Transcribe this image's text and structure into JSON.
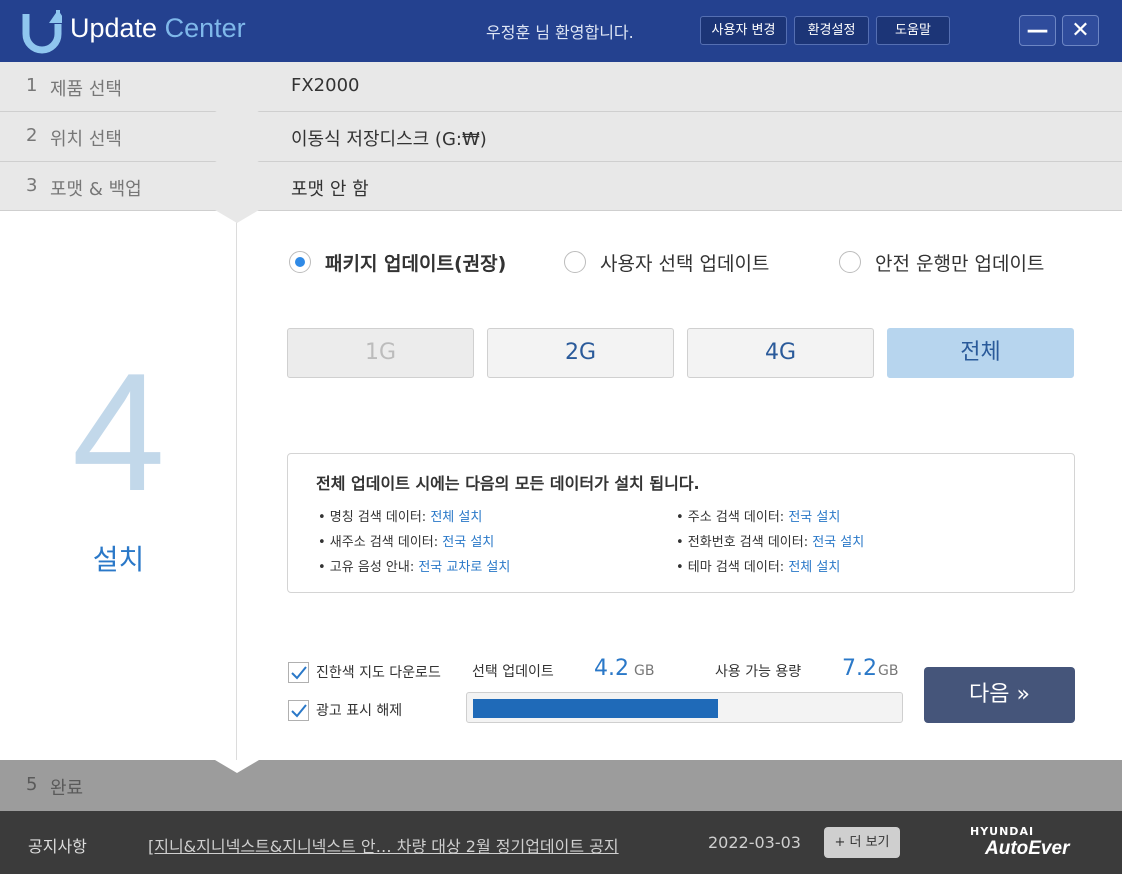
{
  "header": {
    "app_title_a": "Update ",
    "app_title_b": "Center",
    "welcome": "우정훈  님 환영합니다.",
    "buttons": [
      "사용자 변경",
      "환경설정",
      "도움말"
    ],
    "minimize_label": "—",
    "close_label": "✕"
  },
  "steps": [
    {
      "num": "1",
      "label": "제품 선택",
      "value": "FX2000"
    },
    {
      "num": "2",
      "label": "위치 선택",
      "value": "이동식 저장디스크 (G:₩)"
    },
    {
      "num": "3",
      "label": "포맷 & 백업",
      "value": "포맷 안 함"
    }
  ],
  "current_step": {
    "num": "4",
    "label": "설치"
  },
  "final_step": {
    "num": "5",
    "label": "완료"
  },
  "update_options": {
    "selected": "패키지 업데이트(권장)",
    "items": [
      "패키지 업데이트(권장)",
      "사용자 선택 업데이트",
      "안전 운행만 업데이트"
    ]
  },
  "sizes": {
    "items": [
      "1G",
      "2G",
      "4G",
      "전체"
    ],
    "disabled": "1G",
    "selected": "전체"
  },
  "info": {
    "title": "전체 업데이트 시에는 다음의 모든 데이터가 설치 됩니다.",
    "items": [
      {
        "label": "• 명칭 검색 데이터: ",
        "value": "전체 설치"
      },
      {
        "label": "• 주소 검색 데이터: ",
        "value": "전국 설치"
      },
      {
        "label": "• 새주소 검색 데이터: ",
        "value": "전국 설치"
      },
      {
        "label": "• 전화번호 검색 데이터: ",
        "value": "전국 설치"
      },
      {
        "label": "• 고유 음성 안내: ",
        "value": "전국 교차로 설치"
      },
      {
        "label": "• 테마 검색 데이터: ",
        "value": "전체 설치"
      }
    ]
  },
  "options": {
    "dark_map": {
      "label": "진한색 지도 다운로드",
      "checked": true
    },
    "ad_off": {
      "label": "광고 표시 해제",
      "checked": true
    }
  },
  "stats": {
    "selected_label": "선택 업데이트",
    "selected_value": "4.2",
    "available_label": "사용 가능 용량",
    "available_value": "7.2",
    "unit": "GB",
    "usage_ratio": 0.58
  },
  "next_label": "다음 »",
  "footer": {
    "notice_label": "공지사항",
    "notice_text": "[지니&지니넥스트&지니넥스트  안… 차량 대상 2월 정기업데이트 공지",
    "date": "2022-03-03",
    "more_label": "+ 더 보기",
    "brand_top": "HYUNDAI",
    "brand_bottom": "AutoEver"
  },
  "colors": {
    "header": "#24418f",
    "accent": "#2a78c8",
    "progress": "#1f6ab8"
  }
}
